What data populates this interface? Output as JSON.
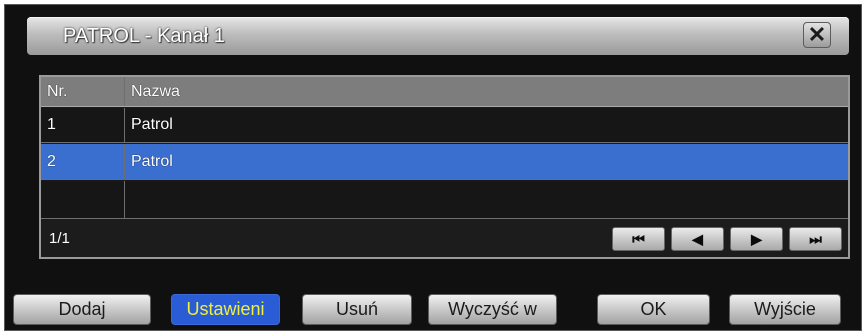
{
  "dialog": {
    "title": "PATROL - Kanał 1",
    "close_label": "✕"
  },
  "table": {
    "headers": [
      "Nr.",
      "Nazwa"
    ],
    "rows": [
      {
        "nr": "1",
        "name": "Patrol"
      },
      {
        "nr": "2",
        "name": "Patrol",
        "selected": true
      }
    ],
    "page_info": "1/1"
  },
  "nav": {
    "first": "⏮",
    "prev": "◀",
    "next": "▶",
    "last": "⏭"
  },
  "buttons": {
    "add": "Dodaj",
    "settings": "Ustawieni",
    "delete": "Usuń",
    "clear": "Wyczyść w",
    "ok": "OK",
    "exit": "Wyjście"
  },
  "colors": {
    "selection": "#3a6fd0",
    "active_button_bg": "#2a5cd6",
    "active_button_text": "#f2ef3a"
  }
}
